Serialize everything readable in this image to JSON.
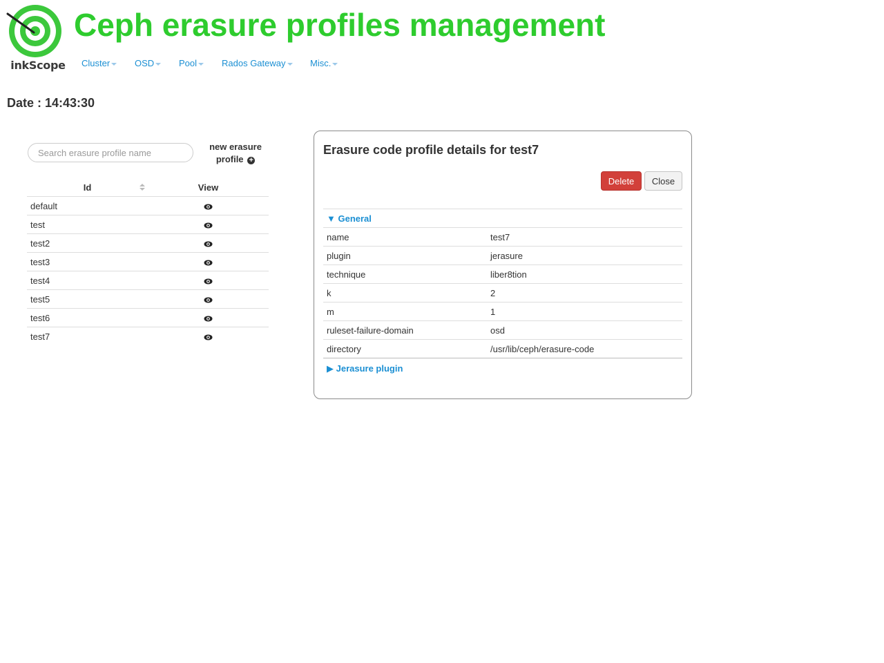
{
  "header": {
    "title": "Ceph erasure profiles management",
    "logo_text": "inkScope",
    "logo_colors": {
      "ring": "#3cc83c",
      "text": "#3a3a3a"
    }
  },
  "nav": {
    "items": [
      {
        "label": "Cluster"
      },
      {
        "label": "OSD"
      },
      {
        "label": "Pool"
      },
      {
        "label": "Rados Gateway"
      },
      {
        "label": "Misc."
      }
    ],
    "link_color": "#1b8fd3"
  },
  "date": {
    "text": "Date : 14:43:30"
  },
  "list": {
    "search_placeholder": "Search erasure profile name",
    "search_value": "",
    "new_profile_label": "new erasure profile",
    "columns": {
      "id": "Id",
      "view": "View"
    },
    "rows": [
      {
        "id": "default"
      },
      {
        "id": "test"
      },
      {
        "id": "test2"
      },
      {
        "id": "test3"
      },
      {
        "id": "test4"
      },
      {
        "id": "test5"
      },
      {
        "id": "test6"
      },
      {
        "id": "test7"
      }
    ]
  },
  "details": {
    "title": "Erasure code profile details for test7",
    "delete_label": "Delete",
    "close_label": "Close",
    "general_section": "▼ General",
    "jerasure_section": "▶ Jerasure plugin",
    "fields": [
      {
        "key": "name",
        "value": "test7"
      },
      {
        "key": "plugin",
        "value": "jerasure"
      },
      {
        "key": "technique",
        "value": "liber8tion"
      },
      {
        "key": "k",
        "value": "2"
      },
      {
        "key": "m",
        "value": "1"
      },
      {
        "key": "ruleset-failure-domain",
        "value": "osd"
      },
      {
        "key": "directory",
        "value": "/usr/lib/ceph/erasure-code"
      }
    ],
    "colors": {
      "delete": "#d2403a",
      "section_link": "#1b8fd3"
    }
  },
  "title_color": "#2ecc2e"
}
